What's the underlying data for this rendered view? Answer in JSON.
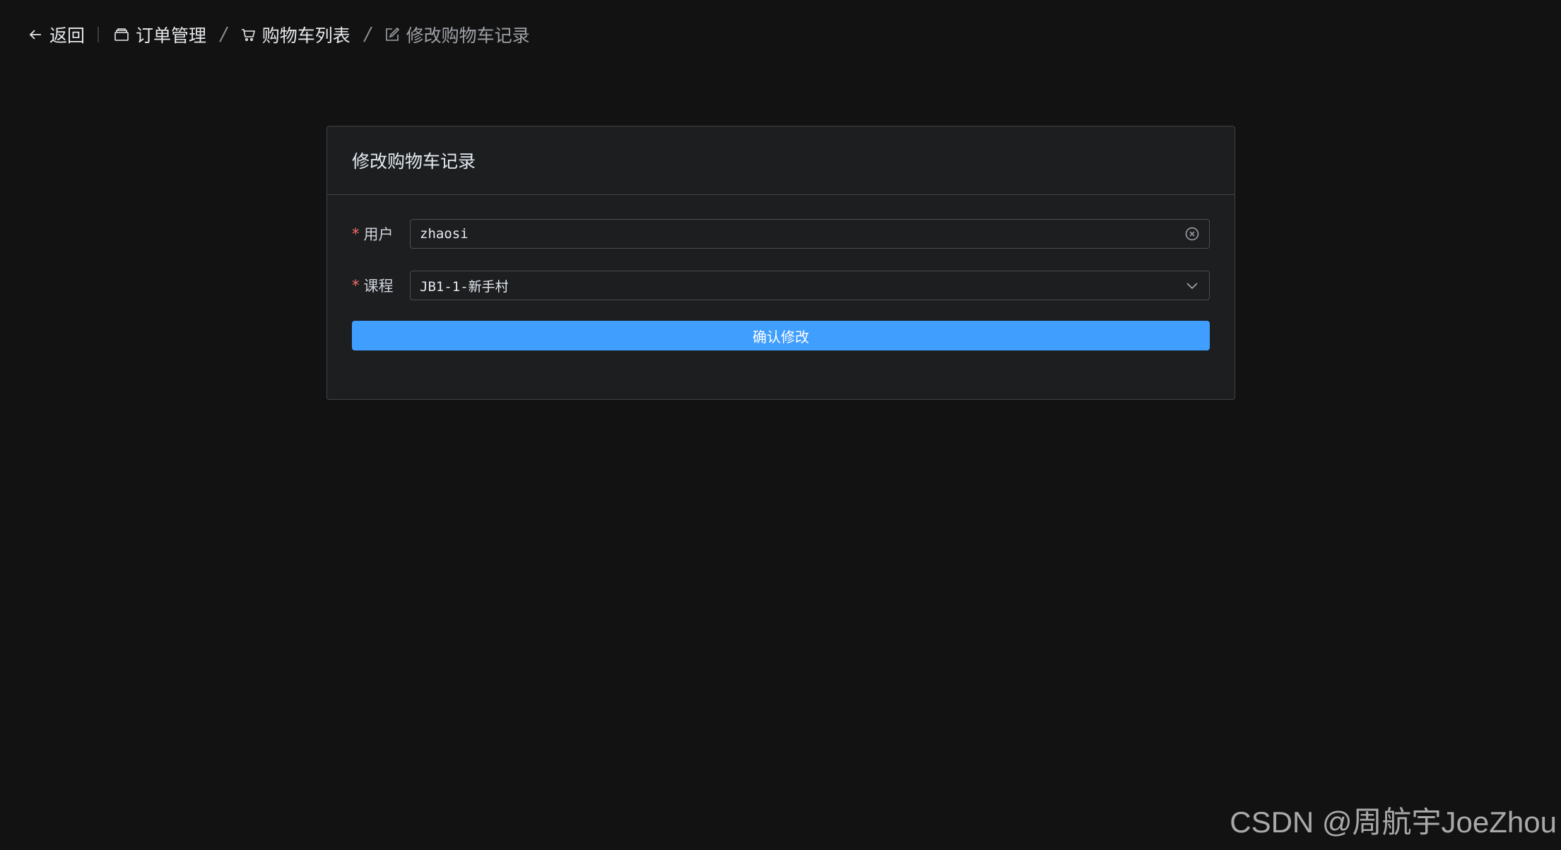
{
  "header": {
    "back_label": "返回",
    "breadcrumbs": [
      {
        "label": "订单管理",
        "icon": "box-icon"
      },
      {
        "label": "购物车列表",
        "icon": "cart-icon"
      },
      {
        "label": "修改购物车记录",
        "icon": "edit-icon"
      }
    ],
    "separator": "/"
  },
  "card": {
    "title": "修改购物车记录",
    "fields": {
      "user": {
        "label": "用户",
        "value": "zhaosi",
        "required": true
      },
      "course": {
        "label": "课程",
        "value": "JB1-1-新手村",
        "required": true
      }
    },
    "required_mark": "*",
    "submit_label": "确认修改"
  },
  "watermark": "CSDN @周航宇JoeZhou",
  "colors": {
    "background": "#121212",
    "card": "#1d1e1f",
    "primary": "#409eff",
    "required": "#f56c6c"
  }
}
